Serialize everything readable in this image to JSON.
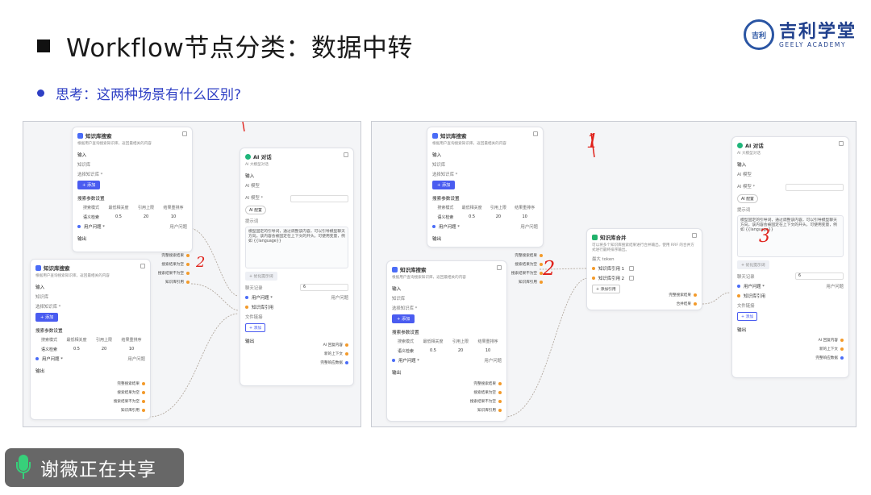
{
  "slide": {
    "title": "Workflow节点分类：数据中转",
    "bullet": "思考：这两种场景有什么区别?"
  },
  "logo": {
    "seal": "吉利",
    "cn": "吉利学堂",
    "en": "GEELY ACADEMY"
  },
  "kb_node": {
    "title": "知识库搜索",
    "desc": "根据用户查询搜索知识库，返回最相关的内容",
    "input_label": "输入",
    "kb_label": "知识库",
    "select_kb": "选择知识库 *",
    "add_button": "+ 添加",
    "settings_label": "搜索参数设置",
    "cols": [
      "搜索模式",
      "最低相关度",
      "引用上限",
      "结果重排序"
    ],
    "vals": [
      "语义检索",
      "0.5",
      "20",
      "10"
    ],
    "query_label": "用户问题 *",
    "query_value": "用户问题",
    "output_label": "输出",
    "outputs": [
      "完整搜索结果",
      "搜索结果为空",
      "搜索结果不为空",
      "知识库引用"
    ]
  },
  "ai_node": {
    "title": "AI 对话",
    "desc": "AI 大模型对话",
    "input_label": "输入",
    "ai_model": "AI 模型",
    "model_label": "AI 模型 *",
    "ai_button": "AI 配置",
    "prompt_label": "提示词",
    "prompt_text": "模型固定的引导词，通过调整该内容，可以引导模型聊天方向。该内容会被固定在上下文的开头。可使用变量，例如 {{language}}",
    "prompt_button": "+ 优化提示词",
    "history_label": "聊天记录",
    "history_value": "6",
    "question_label": "用户问题 *",
    "question_value": "用户问题",
    "kb_ref_label": "知识库引用",
    "file_label": "文件链接",
    "file_button": "+ 添加",
    "output_label": "输出",
    "outputs": [
      "AI 回复内容",
      "新的上下文",
      "完整响应数据"
    ]
  },
  "merge_node": {
    "title": "知识库合并",
    "desc": "可以将多个知识库搜索结果进行合并输出，使用 RRF 的合并方式进行最终排序输出。",
    "field_label": "最大 token",
    "refs": [
      "知识库引用 1",
      "知识库引用 2"
    ],
    "add_button": "+ 添加引用",
    "outputs": [
      "完整搜索结果",
      "合并结果"
    ]
  },
  "annotations": {
    "left_2": "2",
    "right_1": "1",
    "right_2": "2",
    "right_3": "3"
  },
  "sharing": {
    "text": "谢薇正在共享"
  },
  "colors": {
    "accent": "#4a5cf0",
    "bullet": "#2e3fc4",
    "logo": "#1f3f8c",
    "annotation": "#e0221b",
    "share_mic": "#37d07a"
  }
}
